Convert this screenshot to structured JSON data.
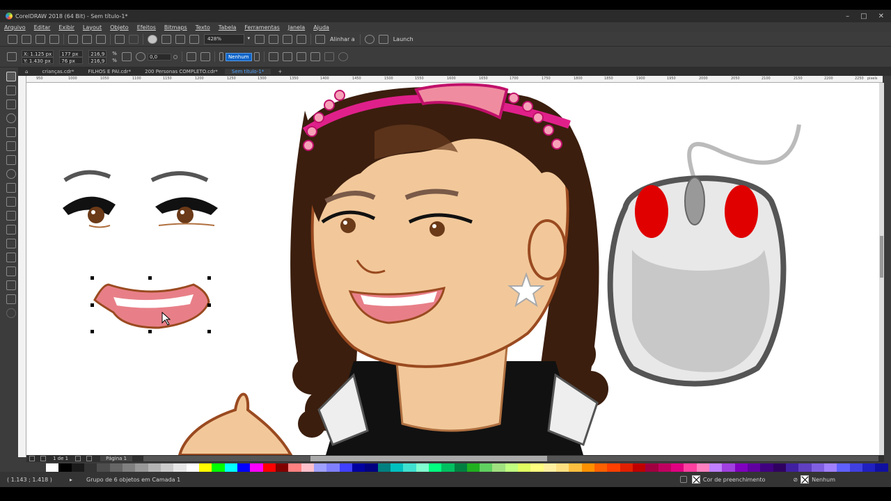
{
  "window": {
    "title": "CorelDRAW 2018 (64 Bit) - Sem título-1*",
    "controls": [
      "–",
      "□",
      "✕"
    ]
  },
  "menu": [
    "Arquivo",
    "Editar",
    "Exibir",
    "Layout",
    "Objeto",
    "Efeitos",
    "Bitmaps",
    "Texto",
    "Tabela",
    "Ferramentas",
    "Janela",
    "Ajuda"
  ],
  "toolbar": {
    "zoom": "428%",
    "align_label": "Alinhar a",
    "launch_label": "Launch"
  },
  "propbar": {
    "x": "X: 1.125 px",
    "y": "Y: 1.430 px",
    "width": "177 px",
    "height": "76 px",
    "scale_w": "216,9",
    "scale_h": "216,9",
    "pct": "%",
    "angle": "0,0",
    "outline": "Nenhum"
  },
  "tabs": [
    {
      "label": "crianças.cdr*",
      "active": false
    },
    {
      "label": "FILHOS E PAI.cdr*",
      "active": false
    },
    {
      "label": "200 Personas COMPLETO.cdr*",
      "active": false
    },
    {
      "label": "Sem título-1*",
      "active": true
    }
  ],
  "ruler_ticks": [
    "950",
    "1000",
    "1050",
    "1100",
    "1150",
    "1200",
    "1250",
    "1300",
    "1350",
    "1400",
    "1450",
    "1500",
    "1550",
    "1600",
    "1650",
    "1700",
    "1750",
    "1800",
    "1850",
    "1900",
    "1950",
    "2000",
    "2050",
    "2100",
    "2150",
    "2200",
    "2250",
    "pixels"
  ],
  "page_nav": {
    "counter": "1 de 1",
    "page": "Página 1"
  },
  "status": {
    "coords": "( 1.143 ; 1.418 )",
    "selection": "Grupo de 6 objetos em Camada 1",
    "fill": "Cor de preenchimento",
    "outline": "Nenhum"
  },
  "colors": {
    "accent": "#0d63c7",
    "skin": "#f2c89a",
    "hair": "#3b1e0e",
    "lip": "#e87f88",
    "mouse_red": "#e00000",
    "headband": "#e0208a"
  },
  "palette": [
    "#ffffff",
    "#000000",
    "#1a1a1a",
    "#333333",
    "#4d4d4d",
    "#666666",
    "#808080",
    "#999999",
    "#b3b3b3",
    "#cccccc",
    "#e6e6e6",
    "#ffffff",
    "#ffff00",
    "#00ff00",
    "#00ffff",
    "#0000ff",
    "#ff00ff",
    "#ff0000",
    "#800000",
    "#ff8080",
    "#ffc0cb",
    "#a0a0ff",
    "#8080ff",
    "#4040ff",
    "#0000a0",
    "#000080",
    "#008080",
    "#00c0c0",
    "#40e0d0",
    "#80ffd0",
    "#00ff80",
    "#00c060",
    "#008040",
    "#20b020",
    "#60d060",
    "#a0e080",
    "#c0ff80",
    "#e0ff60",
    "#ffff80",
    "#fff0a0",
    "#ffe080",
    "#ffc040",
    "#ff9000",
    "#ff6000",
    "#ff4000",
    "#e02000",
    "#c00000",
    "#a00040",
    "#c00060",
    "#e00080",
    "#ff40a0",
    "#ff80c0",
    "#c080ff",
    "#a040e0",
    "#8000c0",
    "#6000a0",
    "#400080",
    "#300060",
    "#4020a0",
    "#6040c0",
    "#8060e0",
    "#a080ff",
    "#6060ff",
    "#4040e0",
    "#2020c0",
    "#1010a0"
  ],
  "icons": [
    "select-tool-icon",
    "shape-tool-icon",
    "crop-tool-icon",
    "zoom-tool-icon",
    "freehand-tool-icon",
    "artistic-media-icon",
    "rectangle-tool-icon",
    "ellipse-tool-icon",
    "polygon-tool-icon",
    "text-tool-icon",
    "parallel-dimension-icon",
    "connector-icon",
    "drop-shadow-icon",
    "transparency-icon",
    "eyedropper-icon",
    "interactive-fill-icon",
    "smart-fill-icon"
  ]
}
